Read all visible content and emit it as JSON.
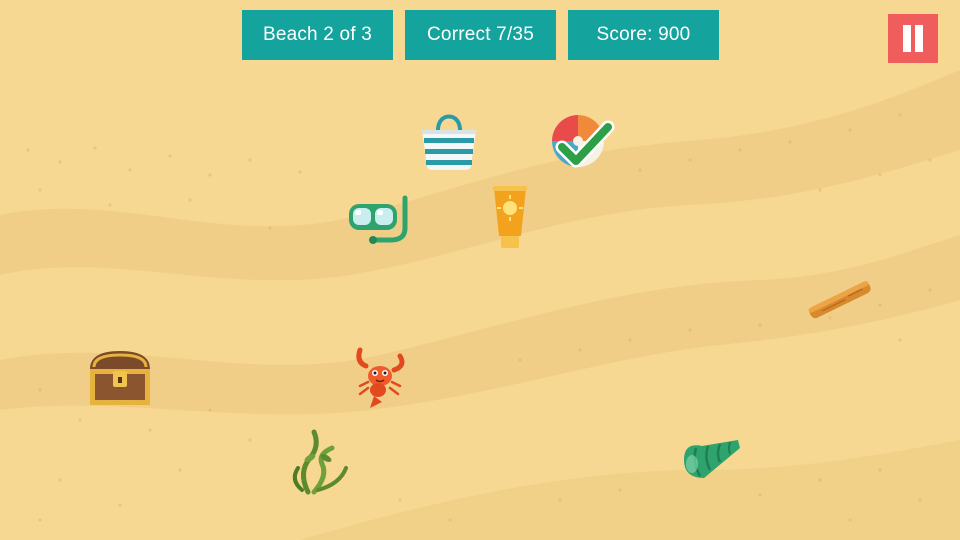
{
  "hud": {
    "level_label": "Beach 2 of 3",
    "correct_label": "Correct 7/35",
    "score_label": "Score: 900"
  },
  "controls": {
    "pause_icon": "pause-icon"
  },
  "colors": {
    "hud_background": "#15a39d",
    "hud_text": "#ffffff",
    "pause_background": "#ef5d5d",
    "sand_light": "#f6d893",
    "sand_dark": "#efc97c",
    "check_green": "#2e9e47"
  },
  "items": [
    {
      "name": "beach-bag-icon",
      "state": "hidden"
    },
    {
      "name": "beach-ball-icon",
      "state": "found"
    },
    {
      "name": "snorkel-mask-icon",
      "state": "hidden"
    },
    {
      "name": "sunscreen-icon",
      "state": "hidden"
    },
    {
      "name": "driftwood-icon",
      "state": "hidden"
    },
    {
      "name": "treasure-chest-icon",
      "state": "hidden"
    },
    {
      "name": "lobster-icon",
      "state": "hidden"
    },
    {
      "name": "seaweed-icon",
      "state": "hidden"
    },
    {
      "name": "seashell-icon",
      "state": "hidden"
    }
  ]
}
